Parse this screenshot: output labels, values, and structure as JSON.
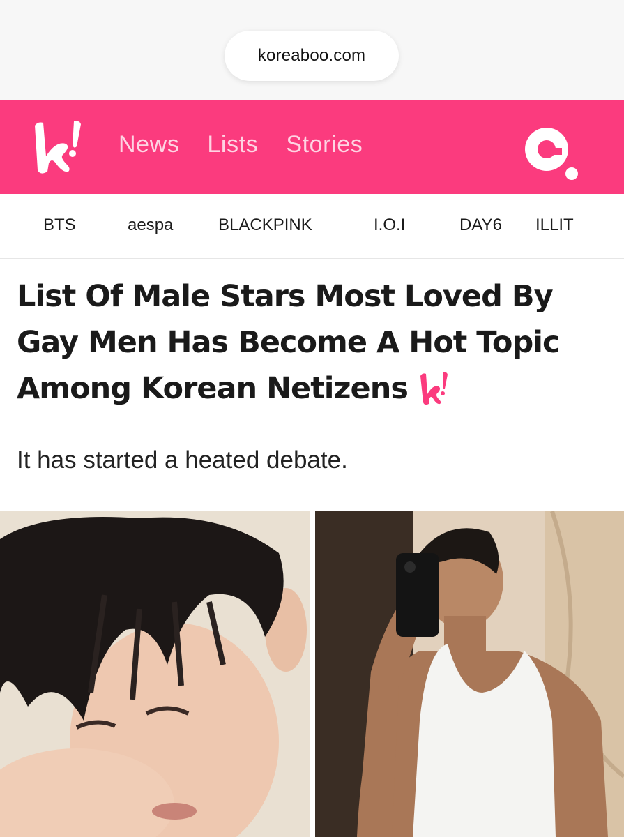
{
  "browser": {
    "url": "koreaboo.com"
  },
  "header": {
    "brand_color": "#fb3b7e",
    "logo_icon": "koreaboo-k-logo",
    "nav": [
      "News",
      "Lists",
      "Stories"
    ],
    "search_icon": "search-icon"
  },
  "categories": [
    "BTS",
    "aespa",
    "BLACKPINK",
    "I.O.I",
    "DAY6",
    "ILLIT"
  ],
  "article": {
    "title": "List Of Male Stars Most Loved By Gay Men Has Become A Hot Topic Among Korean Netizens",
    "subtitle": "It has started a heated debate.",
    "images": [
      "close-up portrait with wet hair",
      "mirror selfie in white tank top"
    ]
  }
}
